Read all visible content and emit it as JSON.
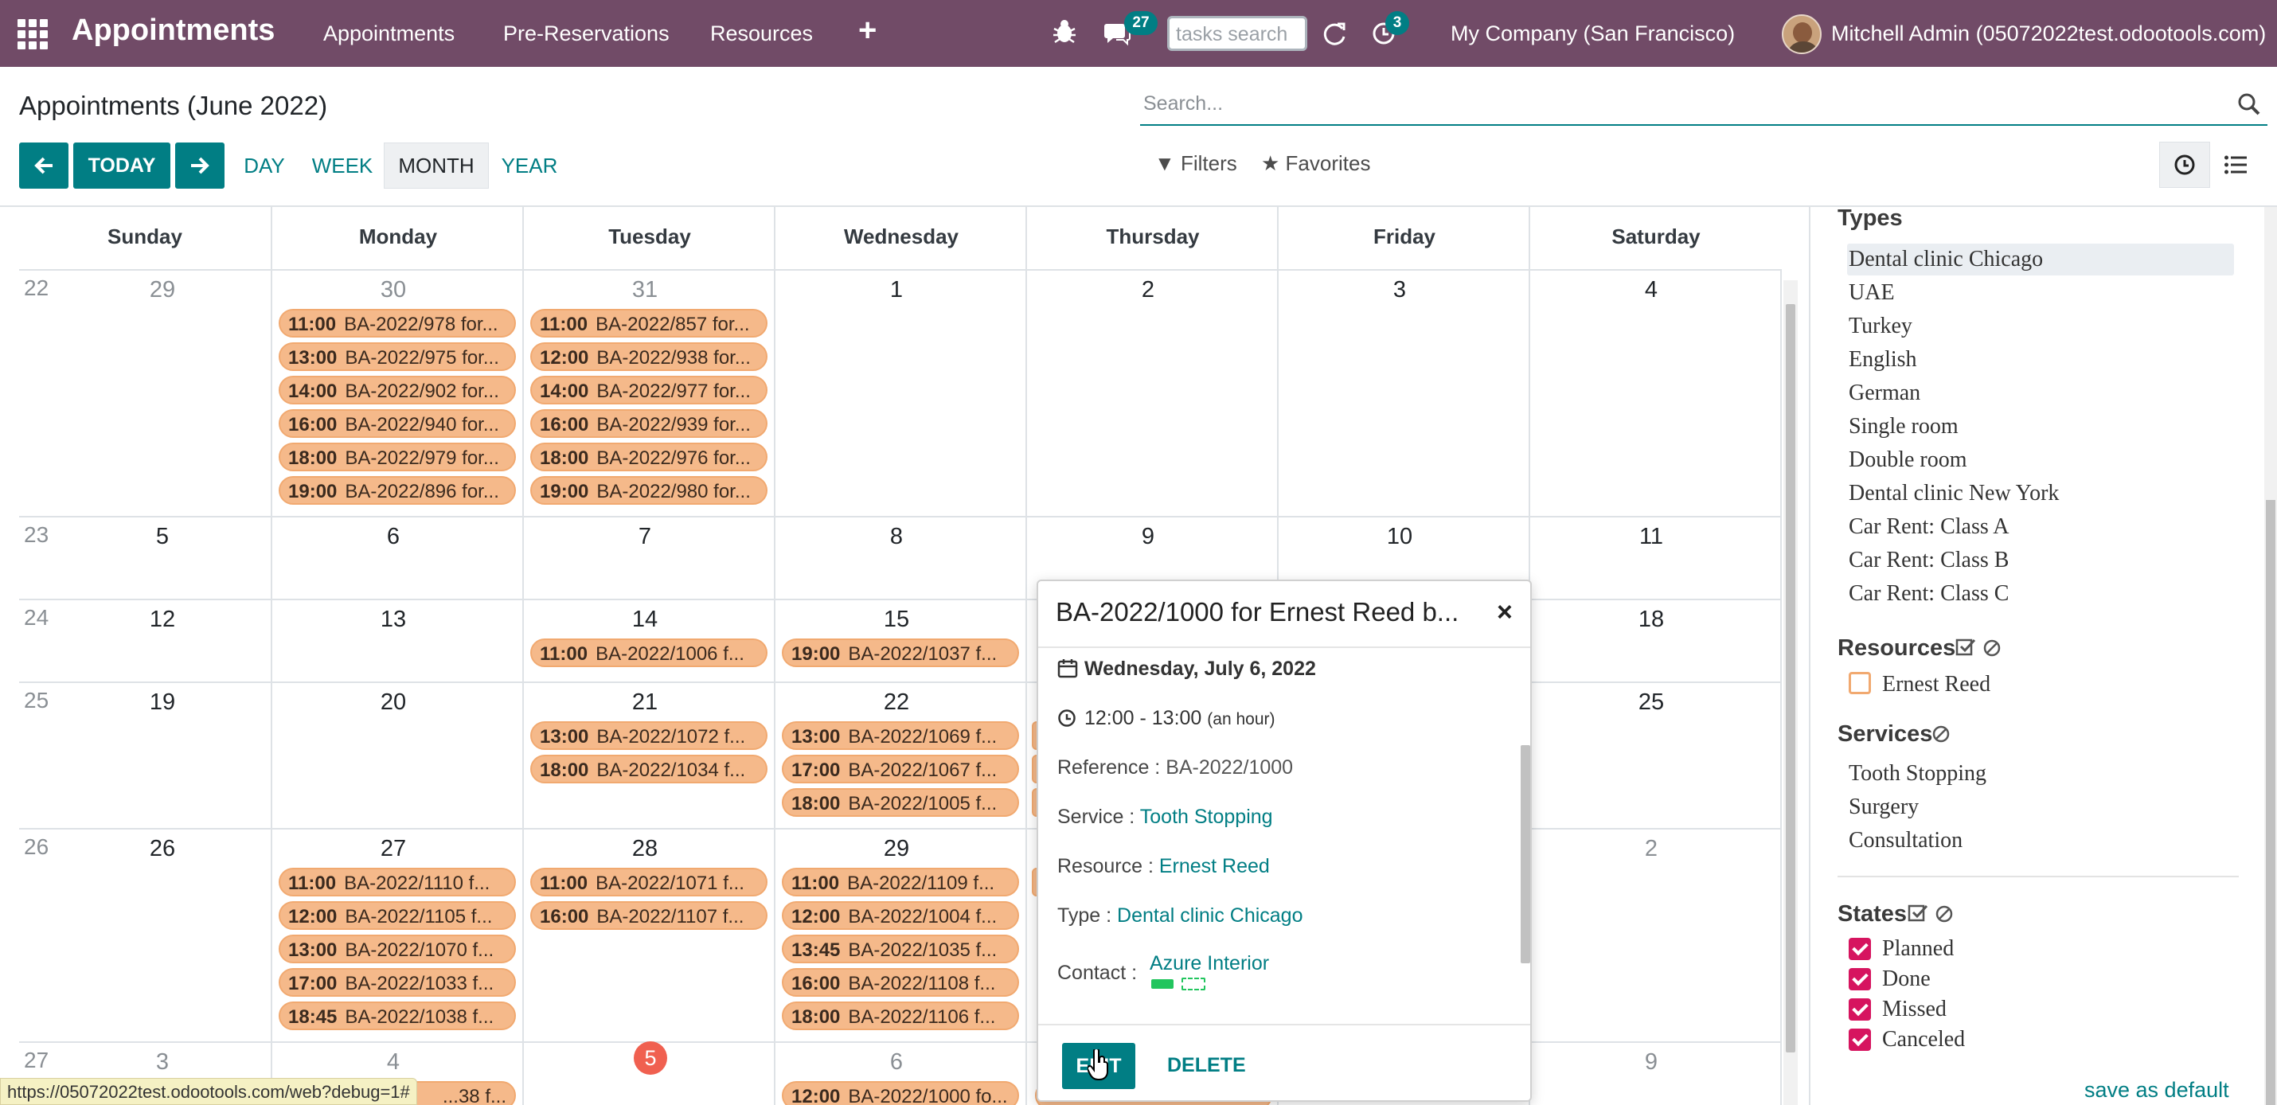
{
  "topbar": {
    "app_title": "Appointments",
    "menu": [
      "Appointments",
      "Pre-Reservations",
      "Resources"
    ],
    "add_icon": "+",
    "messages_count": "27",
    "tasks_search_placeholder": "tasks search",
    "activity_count": "3",
    "company": "My Company (San Francisco)",
    "user": "Mitchell Admin (05072022test.odootools.com)"
  },
  "control": {
    "page_title": "Appointments (June 2022)",
    "search_placeholder": "Search...",
    "today_label": "TODAY",
    "scales": [
      "DAY",
      "WEEK",
      "MONTH",
      "YEAR"
    ],
    "active_scale": "MONTH",
    "filters_label": "Filters",
    "favorites_label": "Favorites"
  },
  "calendar": {
    "day_headers": [
      "Sunday",
      "Monday",
      "Tuesday",
      "Wednesday",
      "Thursday",
      "Friday",
      "Saturday"
    ],
    "weeks": [
      {
        "num": "22",
        "days": [
          "29",
          "30",
          "31",
          "1",
          "2",
          "3",
          "4"
        ]
      },
      {
        "num": "23",
        "days": [
          "5",
          "6",
          "7",
          "8",
          "9",
          "10",
          "11"
        ]
      },
      {
        "num": "24",
        "days": [
          "12",
          "13",
          "14",
          "15",
          "",
          "",
          "18"
        ]
      },
      {
        "num": "25",
        "days": [
          "19",
          "20",
          "21",
          "22",
          "",
          "",
          "25"
        ]
      },
      {
        "num": "26",
        "days": [
          "26",
          "27",
          "28",
          "29",
          "",
          "",
          "2"
        ]
      },
      {
        "num": "27",
        "days": [
          "3",
          "4",
          "5",
          "6",
          "",
          "",
          "9"
        ]
      }
    ],
    "events": {
      "w22_mon": [
        {
          "time": "11:00",
          "title": "BA-2022/978 for..."
        },
        {
          "time": "13:00",
          "title": "BA-2022/975 for..."
        },
        {
          "time": "14:00",
          "title": "BA-2022/902 for..."
        },
        {
          "time": "16:00",
          "title": "BA-2022/940 for..."
        },
        {
          "time": "18:00",
          "title": "BA-2022/979 for..."
        },
        {
          "time": "19:00",
          "title": "BA-2022/896 for..."
        }
      ],
      "w22_tue": [
        {
          "time": "11:00",
          "title": "BA-2022/857 for..."
        },
        {
          "time": "12:00",
          "title": "BA-2022/938 for..."
        },
        {
          "time": "14:00",
          "title": "BA-2022/977 for..."
        },
        {
          "time": "16:00",
          "title": "BA-2022/939 for..."
        },
        {
          "time": "18:00",
          "title": "BA-2022/976 for..."
        },
        {
          "time": "19:00",
          "title": "BA-2022/980 for..."
        }
      ],
      "w24_tue": [
        {
          "time": "11:00",
          "title": "BA-2022/1006 f..."
        }
      ],
      "w24_wed": [
        {
          "time": "19:00",
          "title": "BA-2022/1037 f..."
        }
      ],
      "w25_tue": [
        {
          "time": "13:00",
          "title": "BA-2022/1072 f..."
        },
        {
          "time": "18:00",
          "title": "BA-2022/1034 f..."
        }
      ],
      "w25_wed": [
        {
          "time": "13:00",
          "title": "BA-2022/1069 f..."
        },
        {
          "time": "17:00",
          "title": "BA-2022/1067 f..."
        },
        {
          "time": "18:00",
          "title": "BA-2022/1005 f..."
        }
      ],
      "w26_mon": [
        {
          "time": "11:00",
          "title": "BA-2022/1110 f..."
        },
        {
          "time": "12:00",
          "title": "BA-2022/1105 f..."
        },
        {
          "time": "13:00",
          "title": "BA-2022/1070 f..."
        },
        {
          "time": "17:00",
          "title": "BA-2022/1033 f..."
        },
        {
          "time": "18:45",
          "title": "BA-2022/1038 f..."
        }
      ],
      "w26_tue": [
        {
          "time": "11:00",
          "title": "BA-2022/1071 f..."
        },
        {
          "time": "16:00",
          "title": "BA-2022/1107 f..."
        }
      ],
      "w26_wed": [
        {
          "time": "11:00",
          "title": "BA-2022/1109 f..."
        },
        {
          "time": "12:00",
          "title": "BA-2022/1004 f..."
        },
        {
          "time": "13:45",
          "title": "BA-2022/1035 f..."
        },
        {
          "time": "16:00",
          "title": "BA-2022/1108 f..."
        },
        {
          "time": "18:00",
          "title": "BA-2022/1106 f..."
        }
      ],
      "w27_mon_partial": "...38 f...",
      "w27_wed": [
        {
          "time": "12:00",
          "title": "BA-2022/1000 fo..."
        }
      ]
    }
  },
  "popover": {
    "title": "BA-2022/1000 for Ernest Reed b...",
    "date": "Wednesday, July 6, 2022",
    "time": "12:00 - 13:00",
    "duration": "(an hour)",
    "reference_label": "Reference :",
    "reference": "BA-2022/1000",
    "service_label": "Service :",
    "service": "Tooth Stopping",
    "resource_label": "Resource :",
    "resource": "Ernest Reed",
    "type_label": "Type :",
    "type": "Dental clinic Chicago",
    "contact_label": "Contact :",
    "contact": "Azure Interior",
    "edit_label": "EDIT",
    "delete_label": "DELETE"
  },
  "sidebar": {
    "types_title": "Types",
    "types": [
      "Dental clinic Chicago",
      "UAE",
      "Turkey",
      "English",
      "German",
      "Single room",
      "Double room",
      "Dental clinic New York",
      "Car Rent: Class A",
      "Car Rent: Class B",
      "Car Rent: Class C"
    ],
    "resources_title": "Resources",
    "resources": [
      "Ernest Reed"
    ],
    "services_title": "Services",
    "services": [
      "Tooth Stopping",
      "Surgery",
      "Consultation"
    ],
    "states_title": "States",
    "states": [
      "Planned",
      "Done",
      "Missed",
      "Canceled"
    ],
    "save_default": "save as default"
  },
  "statusbar": {
    "url": "https://05072022test.odootools.com/web?debug=1#"
  },
  "colors": {
    "brand": "#714B67",
    "accent": "#017e84",
    "event": "#f5b98a",
    "today": "#f06050",
    "checkbox": "#d6145f"
  }
}
